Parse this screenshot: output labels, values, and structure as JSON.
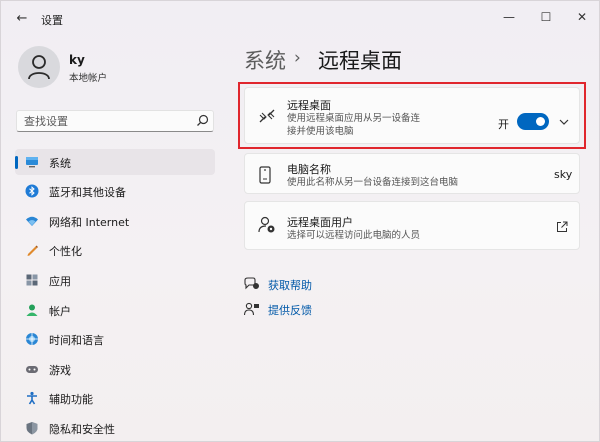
{
  "window": {
    "title": "设置",
    "back_glyph": "←",
    "min_glyph": "—",
    "max_glyph": "☐",
    "close_glyph": "✕"
  },
  "profile": {
    "name": "ky",
    "account_type": "本地帐户"
  },
  "search": {
    "placeholder": "查找设置"
  },
  "sidebar": {
    "items": [
      {
        "label": "系统",
        "icon": "monitor-icon",
        "active": true
      },
      {
        "label": "蓝牙和其他设备",
        "icon": "bluetooth-icon"
      },
      {
        "label": "网络和 Internet",
        "icon": "wifi-icon"
      },
      {
        "label": "个性化",
        "icon": "pen-icon"
      },
      {
        "label": "应用",
        "icon": "apps-icon"
      },
      {
        "label": "帐户",
        "icon": "account-icon"
      },
      {
        "label": "时间和语言",
        "icon": "globe-icon"
      },
      {
        "label": "游戏",
        "icon": "gamepad-icon"
      },
      {
        "label": "辅助功能",
        "icon": "accessibility-icon"
      },
      {
        "label": "隐私和安全性",
        "icon": "shield-icon"
      }
    ]
  },
  "breadcrumb": {
    "root": "系统",
    "separator": "›",
    "current": "远程桌面"
  },
  "cards": {
    "remote_desktop": {
      "title": "远程桌面",
      "desc_line1": "使用远程桌面应用从另一设备连",
      "desc_line2": "接并使用该电脑",
      "toggle_label": "开",
      "toggle_on": true
    },
    "pc_name": {
      "title": "电脑名称",
      "desc": "使用此名称从另一台设备连接到这台电脑",
      "value": "sky"
    },
    "remote_users": {
      "title": "远程桌面用户",
      "desc": "选择可以远程访问此电脑的人员"
    }
  },
  "help": {
    "get_help": "获取帮助",
    "feedback": "提供反馈"
  },
  "colors": {
    "accent": "#0067c0",
    "highlight": "#e0262d",
    "link": "#0058a8"
  }
}
